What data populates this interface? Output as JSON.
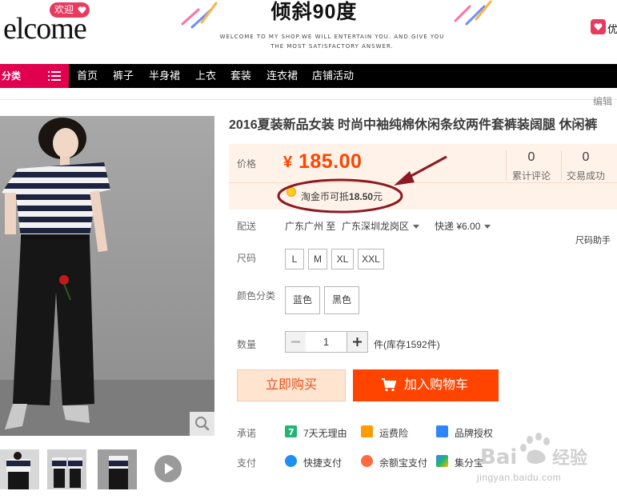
{
  "header": {
    "welcome_badge": "欢迎",
    "welcome_text": "elcome",
    "banner_title": "倾斜90度",
    "banner_subtitle_line1": "WELCOME TO MY SHOP.WE WILL ENTERTAIN YOU. AND GIVE YOU",
    "banner_subtitle_line2": "THE MOST SATISFACTORY ANSWER.",
    "favorite_label": "优"
  },
  "nav": {
    "category_label": "分类",
    "items": [
      "首页",
      "裤子",
      "半身裙",
      "上衣",
      "套装",
      "连衣裙",
      "店铺活动"
    ]
  },
  "edit_label": "编辑",
  "product": {
    "title": "2016夏装新品女装 时尚中袖纯棉休闲条纹两件套裤装阔腿 休闲裤",
    "price_label": "价格",
    "currency": "¥",
    "price": "185.00",
    "stats": [
      {
        "count": "0",
        "label": "累计评论"
      },
      {
        "count": "0",
        "label": "交易成功"
      }
    ],
    "coin_prefix": "淘金币可抵",
    "coin_amount": "18.50",
    "coin_suffix": "元"
  },
  "delivery": {
    "label": "配送",
    "from": "广东广州 至",
    "to": "广东深圳龙岗区",
    "method": "快递 ¥6.00"
  },
  "size": {
    "label": "尺码",
    "helper": "尺码助手",
    "options": [
      "L",
      "M",
      "XL",
      "XXL"
    ]
  },
  "color": {
    "label": "颜色分类",
    "options": [
      "蓝色",
      "黑色"
    ]
  },
  "quantity": {
    "label": "数量",
    "value": "1",
    "stock": "件(库存1592件)"
  },
  "actions": {
    "buy_now": "立即购买",
    "add_to_cart": "加入购物车"
  },
  "promise": {
    "label": "承诺",
    "items": [
      "7天无理由",
      "运费险",
      "品牌授权"
    ]
  },
  "payment": {
    "label": "支付",
    "items": [
      "快捷支付",
      "余额宝支付",
      "集分宝"
    ]
  },
  "watermark": {
    "url": "jingyan.baidu.com"
  },
  "colors": {
    "accent_orange": "#ff4400",
    "nav_pink": "#e0004d",
    "annotation_red": "#8b1a24"
  }
}
